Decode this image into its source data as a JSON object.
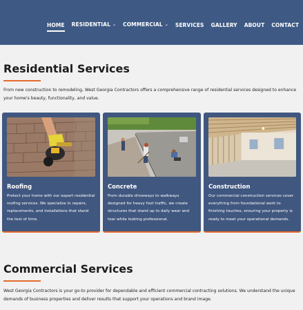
{
  "nav": {
    "items": [
      {
        "label": "HOME"
      },
      {
        "label": "RESIDENTIAL"
      },
      {
        "label": "COMMERCIAL"
      },
      {
        "label": "SERVICES"
      },
      {
        "label": "GALLERY"
      },
      {
        "label": "ABOUT"
      },
      {
        "label": "CONTACT"
      }
    ],
    "active": "HOME",
    "dropdown_icon": "chevron-down-icon"
  },
  "residential": {
    "title": "Residential Services",
    "intro": "From new construction to remodeling, West Georgia Contractors offers a comprehensive range of residential services designed to enhance your home's beauty, functionality, and value.",
    "cards": [
      {
        "title": "Roofing",
        "text": "Protect your home with our expert residential roofing services. We specialize in repairs, replacements, and installations that stand the test of time."
      },
      {
        "title": "Concrete",
        "text": "From durable driveways to walkways designed for heavy foot traffic, we create structures that stand up to daily wear and tear while looking professional."
      },
      {
        "title": "Construction",
        "text": "Our commercial construction services cover everything from foundational work to finishing touches, ensuring your property is ready to meet your operational demands."
      }
    ]
  },
  "commercial": {
    "title": "Commercial Services",
    "intro": "West Georgia Contractors is your go-to provider for dependable and efficient commercial contracting solutions. We understand the unique demands of business properties and deliver results that support your operations and brand image."
  },
  "colors": {
    "nav_bg": "#3e5a84",
    "card_bg": "#40577f",
    "accent": "#e46a2c",
    "page_bg": "#f1f1f1"
  }
}
